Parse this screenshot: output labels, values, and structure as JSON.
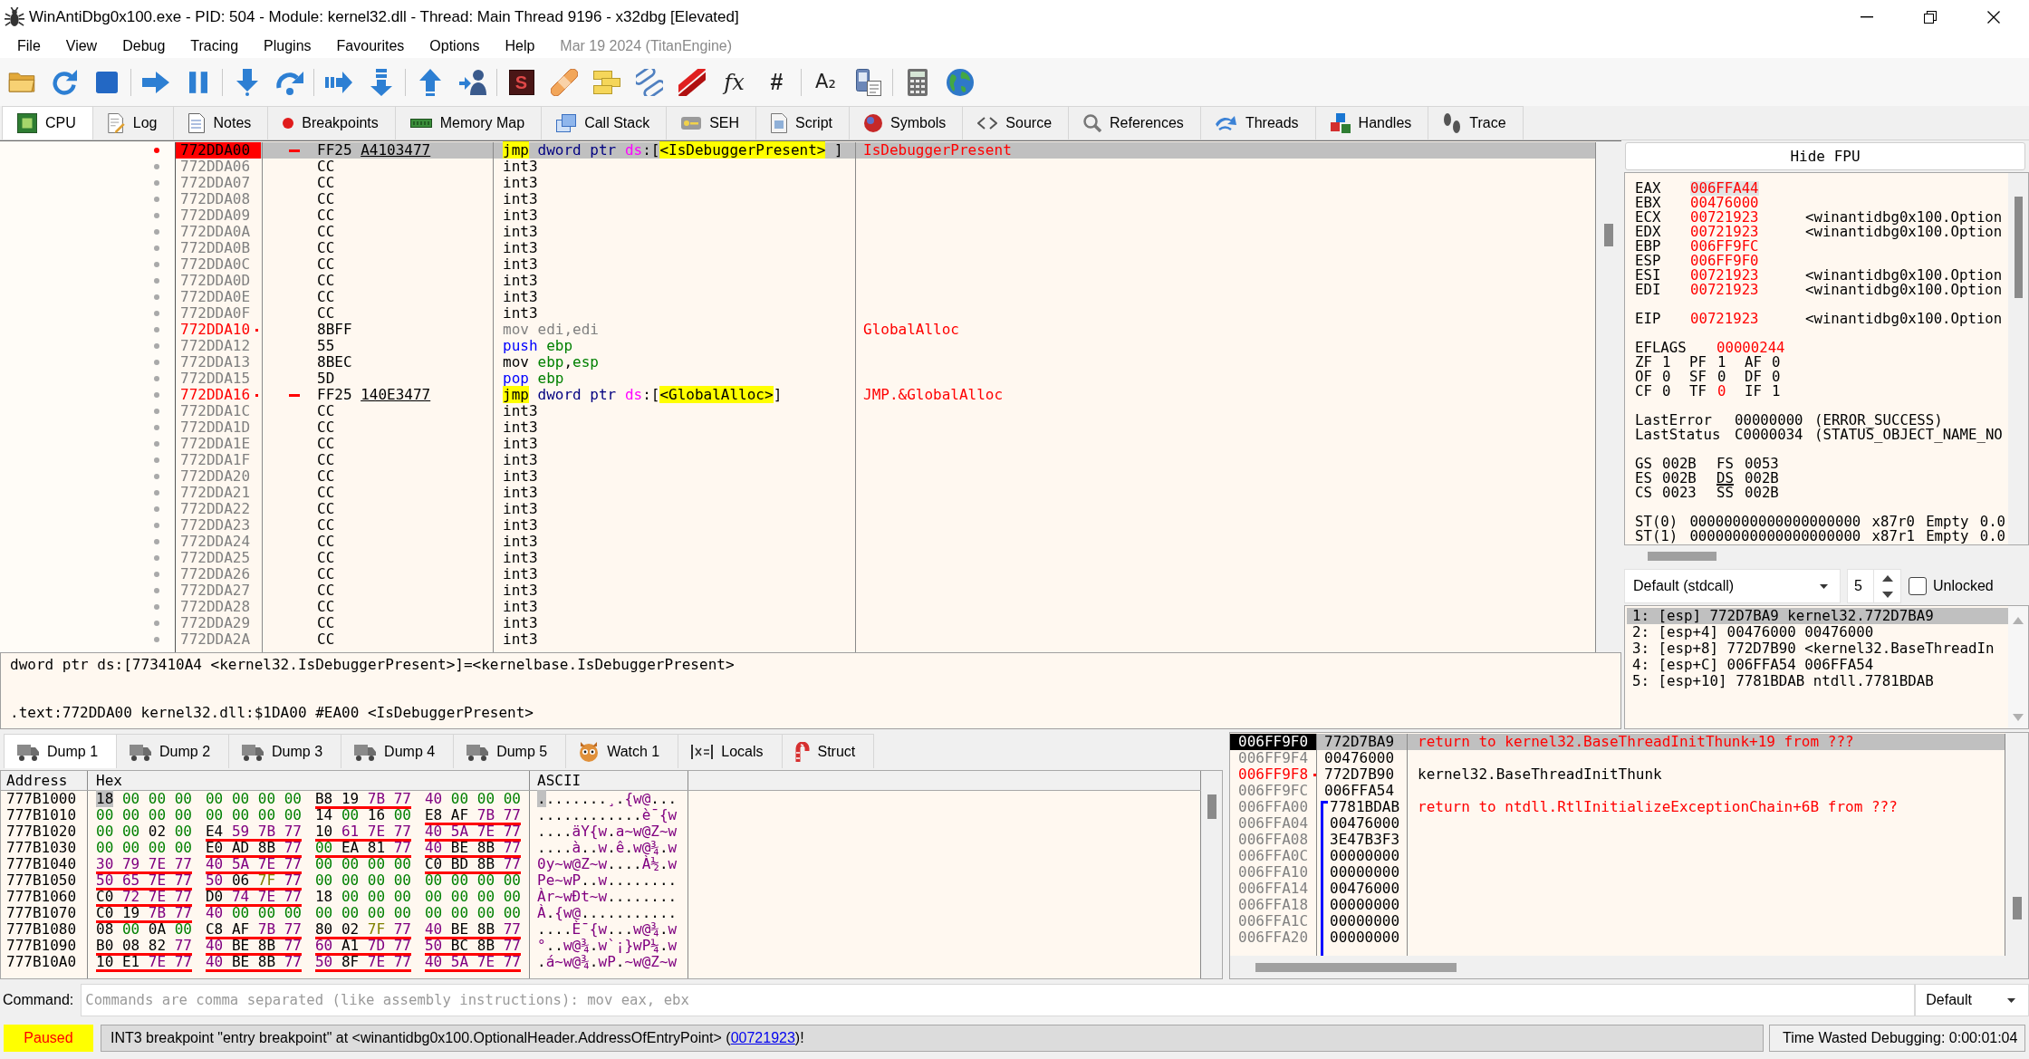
{
  "window": {
    "title": "WinAntiDbg0x100.exe - PID: 504 - Module: kernel32.dll - Thread: Main Thread 9196 - x32dbg [Elevated]"
  },
  "menu": {
    "items": [
      "File",
      "View",
      "Debug",
      "Tracing",
      "Plugins",
      "Favourites",
      "Options",
      "Help"
    ],
    "build": "Mar 19 2024 (TitanEngine)"
  },
  "toolbar": {
    "glyph_buttons": [
      "S",
      "fx",
      "#",
      "A₂"
    ]
  },
  "tabs": [
    {
      "label": "CPU",
      "kind": "cpu",
      "selected": true
    },
    {
      "label": "Log",
      "kind": "log",
      "selected": false
    },
    {
      "label": "Notes",
      "kind": "notes",
      "selected": false
    },
    {
      "label": "Breakpoints",
      "kind": "breakpoints",
      "selected": false
    },
    {
      "label": "Memory Map",
      "kind": "memory",
      "selected": false
    },
    {
      "label": "Call Stack",
      "kind": "callstack",
      "selected": false
    },
    {
      "label": "SEH",
      "kind": "seh",
      "selected": false
    },
    {
      "label": "Script",
      "kind": "script",
      "selected": false
    },
    {
      "label": "Symbols",
      "kind": "symbols",
      "selected": false
    },
    {
      "label": "Source",
      "kind": "source",
      "selected": false
    },
    {
      "label": "References",
      "kind": "references",
      "selected": false
    },
    {
      "label": "Threads",
      "kind": "threads",
      "selected": false
    },
    {
      "label": "Handles",
      "kind": "handles",
      "selected": false
    },
    {
      "label": "Trace",
      "kind": "trace",
      "selected": false
    }
  ],
  "disassembly": {
    "rows": [
      {
        "address": "772DDA00",
        "labeled": false,
        "breakpoint": true,
        "selected": true,
        "jump": true,
        "bytes": "FF25",
        "reloc": "A4103477",
        "instruction": [
          {
            "text": "jmp",
            "kind": "branch"
          },
          {
            "text": " dword ptr ",
            "kind": "size"
          },
          {
            "text": "ds",
            "kind": "segment"
          },
          {
            "text": ":[",
            "kind": "punct"
          },
          {
            "text": "<IsDebuggerPresent>",
            "kind": "symbol"
          },
          {
            "text": " ]",
            "kind": "punct"
          }
        ],
        "comment": "IsDebuggerPresent"
      },
      {
        "address": "772DDA06",
        "labeled": false,
        "breakpoint": false,
        "selected": false,
        "jump": false,
        "bytes": "CC",
        "instruction": [
          {
            "text": "int3",
            "kind": "mnemonic"
          }
        ]
      },
      {
        "address": "772DDA07",
        "labeled": false,
        "breakpoint": false,
        "selected": false,
        "jump": false,
        "bytes": "CC",
        "instruction": [
          {
            "text": "int3",
            "kind": "mnemonic"
          }
        ]
      },
      {
        "address": "772DDA08",
        "labeled": false,
        "breakpoint": false,
        "selected": false,
        "jump": false,
        "bytes": "CC",
        "instruction": [
          {
            "text": "int3",
            "kind": "mnemonic"
          }
        ]
      },
      {
        "address": "772DDA09",
        "labeled": false,
        "breakpoint": false,
        "selected": false,
        "jump": false,
        "bytes": "CC",
        "instruction": [
          {
            "text": "int3",
            "kind": "mnemonic"
          }
        ]
      },
      {
        "address": "772DDA0A",
        "labeled": false,
        "breakpoint": false,
        "selected": false,
        "jump": false,
        "bytes": "CC",
        "instruction": [
          {
            "text": "int3",
            "kind": "mnemonic"
          }
        ]
      },
      {
        "address": "772DDA0B",
        "labeled": false,
        "breakpoint": false,
        "selected": false,
        "jump": false,
        "bytes": "CC",
        "instruction": [
          {
            "text": "int3",
            "kind": "mnemonic"
          }
        ]
      },
      {
        "address": "772DDA0C",
        "labeled": false,
        "breakpoint": false,
        "selected": false,
        "jump": false,
        "bytes": "CC",
        "instruction": [
          {
            "text": "int3",
            "kind": "mnemonic"
          }
        ]
      },
      {
        "address": "772DDA0D",
        "labeled": false,
        "breakpoint": false,
        "selected": false,
        "jump": false,
        "bytes": "CC",
        "instruction": [
          {
            "text": "int3",
            "kind": "mnemonic"
          }
        ]
      },
      {
        "address": "772DDA0E",
        "labeled": false,
        "breakpoint": false,
        "selected": false,
        "jump": false,
        "bytes": "CC",
        "instruction": [
          {
            "text": "int3",
            "kind": "mnemonic"
          }
        ]
      },
      {
        "address": "772DDA0F",
        "labeled": false,
        "breakpoint": false,
        "selected": false,
        "jump": false,
        "bytes": "CC",
        "instruction": [
          {
            "text": "int3",
            "kind": "mnemonic"
          }
        ]
      },
      {
        "address": "772DDA10",
        "labeled": true,
        "breakpoint": false,
        "selected": false,
        "jump": false,
        "bytes": "8BFF",
        "instruction": [
          {
            "text": "mov edi,edi",
            "kind": "nop"
          }
        ],
        "comment": "GlobalAlloc"
      },
      {
        "address": "772DDA12",
        "labeled": false,
        "breakpoint": false,
        "selected": false,
        "jump": false,
        "bytes": "55",
        "instruction": [
          {
            "text": "push",
            "kind": "stack"
          },
          {
            "text": " ebp",
            "kind": "register"
          }
        ]
      },
      {
        "address": "772DDA13",
        "labeled": false,
        "breakpoint": false,
        "selected": false,
        "jump": false,
        "bytes": "8BEC",
        "instruction": [
          {
            "text": "mov",
            "kind": "mnemonic"
          },
          {
            "text": " ebp",
            "kind": "register"
          },
          {
            "text": ",",
            "kind": "punct"
          },
          {
            "text": "esp",
            "kind": "register"
          }
        ]
      },
      {
        "address": "772DDA15",
        "labeled": false,
        "breakpoint": false,
        "selected": false,
        "jump": false,
        "bytes": "5D",
        "instruction": [
          {
            "text": "pop",
            "kind": "stack"
          },
          {
            "text": " ebp",
            "kind": "register"
          }
        ]
      },
      {
        "address": "772DDA16",
        "labeled": true,
        "breakpoint": false,
        "selected": false,
        "jump": true,
        "bytes": "FF25",
        "reloc": "140E3477",
        "instruction": [
          {
            "text": "jmp",
            "kind": "branch"
          },
          {
            "text": " dword ptr ",
            "kind": "size"
          },
          {
            "text": "ds",
            "kind": "segment"
          },
          {
            "text": ":[",
            "kind": "punct"
          },
          {
            "text": "<GlobalAlloc>",
            "kind": "symbol"
          },
          {
            "text": "]",
            "kind": "punct"
          }
        ],
        "comment": "JMP.&GlobalAlloc"
      },
      {
        "address": "772DDA1C",
        "labeled": false,
        "breakpoint": false,
        "selected": false,
        "jump": false,
        "bytes": "CC",
        "instruction": [
          {
            "text": "int3",
            "kind": "mnemonic"
          }
        ]
      },
      {
        "address": "772DDA1D",
        "labeled": false,
        "breakpoint": false,
        "selected": false,
        "jump": false,
        "bytes": "CC",
        "instruction": [
          {
            "text": "int3",
            "kind": "mnemonic"
          }
        ]
      },
      {
        "address": "772DDA1E",
        "labeled": false,
        "breakpoint": false,
        "selected": false,
        "jump": false,
        "bytes": "CC",
        "instruction": [
          {
            "text": "int3",
            "kind": "mnemonic"
          }
        ]
      },
      {
        "address": "772DDA1F",
        "labeled": false,
        "breakpoint": false,
        "selected": false,
        "jump": false,
        "bytes": "CC",
        "instruction": [
          {
            "text": "int3",
            "kind": "mnemonic"
          }
        ]
      },
      {
        "address": "772DDA20",
        "labeled": false,
        "breakpoint": false,
        "selected": false,
        "jump": false,
        "bytes": "CC",
        "instruction": [
          {
            "text": "int3",
            "kind": "mnemonic"
          }
        ]
      },
      {
        "address": "772DDA21",
        "labeled": false,
        "breakpoint": false,
        "selected": false,
        "jump": false,
        "bytes": "CC",
        "instruction": [
          {
            "text": "int3",
            "kind": "mnemonic"
          }
        ]
      },
      {
        "address": "772DDA22",
        "labeled": false,
        "breakpoint": false,
        "selected": false,
        "jump": false,
        "bytes": "CC",
        "instruction": [
          {
            "text": "int3",
            "kind": "mnemonic"
          }
        ]
      },
      {
        "address": "772DDA23",
        "labeled": false,
        "breakpoint": false,
        "selected": false,
        "jump": false,
        "bytes": "CC",
        "instruction": [
          {
            "text": "int3",
            "kind": "mnemonic"
          }
        ]
      },
      {
        "address": "772DDA24",
        "labeled": false,
        "breakpoint": false,
        "selected": false,
        "jump": false,
        "bytes": "CC",
        "instruction": [
          {
            "text": "int3",
            "kind": "mnemonic"
          }
        ]
      },
      {
        "address": "772DDA25",
        "labeled": false,
        "breakpoint": false,
        "selected": false,
        "jump": false,
        "bytes": "CC",
        "instruction": [
          {
            "text": "int3",
            "kind": "mnemonic"
          }
        ]
      },
      {
        "address": "772DDA26",
        "labeled": false,
        "breakpoint": false,
        "selected": false,
        "jump": false,
        "bytes": "CC",
        "instruction": [
          {
            "text": "int3",
            "kind": "mnemonic"
          }
        ]
      },
      {
        "address": "772DDA27",
        "labeled": false,
        "breakpoint": false,
        "selected": false,
        "jump": false,
        "bytes": "CC",
        "instruction": [
          {
            "text": "int3",
            "kind": "mnemonic"
          }
        ]
      },
      {
        "address": "772DDA28",
        "labeled": false,
        "breakpoint": false,
        "selected": false,
        "jump": false,
        "bytes": "CC",
        "instruction": [
          {
            "text": "int3",
            "kind": "mnemonic"
          }
        ]
      },
      {
        "address": "772DDA29",
        "labeled": false,
        "breakpoint": false,
        "selected": false,
        "jump": false,
        "bytes": "CC",
        "instruction": [
          {
            "text": "int3",
            "kind": "mnemonic"
          }
        ]
      },
      {
        "address": "772DDA2A",
        "labeled": false,
        "breakpoint": false,
        "selected": false,
        "jump": false,
        "bytes": "CC",
        "instruction": [
          {
            "text": "int3",
            "kind": "mnemonic"
          }
        ]
      }
    ]
  },
  "info": {
    "lines": [
      "dword ptr ds:[773410A4 <kernel32.IsDebuggerPresent>]=<kernelbase.IsDebuggerPresent>",
      ".text:772DDA00 kernel32.dll:$1DA00 #EA00 <IsDebuggerPresent>"
    ]
  },
  "registers": {
    "toggle": "Hide FPU",
    "general": [
      {
        "name": "EAX",
        "value": "006FFA44",
        "changed": true,
        "selected": true
      },
      {
        "name": "EBX",
        "value": "00476000",
        "changed": true,
        "selected": false
      },
      {
        "name": "ECX",
        "value": "00721923",
        "changed": true,
        "selected": false,
        "comment": "<winantidbg0x100.Option"
      },
      {
        "name": "EDX",
        "value": "00721923",
        "changed": true,
        "selected": false,
        "comment": "<winantidbg0x100.Option"
      },
      {
        "name": "EBP",
        "value": "006FF9FC",
        "changed": true,
        "selected": false
      },
      {
        "name": "ESP",
        "value": "006FF9F0",
        "changed": true,
        "selected": false
      },
      {
        "name": "ESI",
        "value": "00721923",
        "changed": true,
        "selected": false,
        "comment": "<winantidbg0x100.Option"
      },
      {
        "name": "EDI",
        "value": "00721923",
        "changed": true,
        "selected": false,
        "comment": "<winantidbg0x100.Option"
      }
    ],
    "instruction_pointer": {
      "name": "EIP",
      "value": "00721923",
      "changed": true,
      "selected": false,
      "comment": "<winantidbg0x100.Option"
    },
    "eflags": {
      "name": "EFLAGS",
      "value": "00000244",
      "changed": true
    },
    "flags": [
      {
        "name": "ZF",
        "value": "1",
        "changed": false
      },
      {
        "name": "PF",
        "value": "1",
        "changed": false
      },
      {
        "name": "AF",
        "value": "0",
        "changed": false
      },
      {
        "name": "OF",
        "value": "0",
        "changed": false
      },
      {
        "name": "SF",
        "value": "0",
        "changed": false
      },
      {
        "name": "DF",
        "value": "0",
        "changed": false
      },
      {
        "name": "CF",
        "value": "0",
        "changed": false
      },
      {
        "name": "TF",
        "value": "0",
        "changed": true
      },
      {
        "name": "IF",
        "value": "1",
        "changed": false
      }
    ],
    "last": [
      {
        "name": "LastError",
        "value": "00000000",
        "comment": "(ERROR_SUCCESS)"
      },
      {
        "name": "LastStatus",
        "value": "C0000034",
        "comment": "(STATUS_OBJECT_NAME_NO"
      }
    ],
    "segments": [
      {
        "name": "GS",
        "value": "002B",
        "in_use": false
      },
      {
        "name": "FS",
        "value": "0053",
        "in_use": false
      },
      {
        "name": "ES",
        "value": "002B",
        "in_use": false
      },
      {
        "name": "DS",
        "value": "002B",
        "in_use": true
      },
      {
        "name": "CS",
        "value": "0023",
        "in_use": false
      },
      {
        "name": "SS",
        "value": "002B",
        "in_use": false
      }
    ],
    "fpu": [
      {
        "name": "ST(0)",
        "value": "00000000000000000000",
        "register": "x87r0",
        "tag": "Empty",
        "number": "0.0"
      },
      {
        "name": "ST(1)",
        "value": "00000000000000000000",
        "register": "x87r1",
        "tag": "Empty",
        "number": "0.0"
      }
    ]
  },
  "call_args": {
    "convention": "Default (stdcall)",
    "count": "5",
    "checkbox": {
      "label": "Unlocked",
      "checked": false
    },
    "rows": [
      {
        "text": "1: [esp] 772D7BA9 kernel32.772D7BA9",
        "selected": true
      },
      {
        "text": "2: [esp+4] 00476000 00476000",
        "selected": false
      },
      {
        "text": "3: [esp+8] 772D7B90 <kernel32.BaseThreadIn",
        "selected": false
      },
      {
        "text": "4: [esp+C] 006FFA54 006FFA54",
        "selected": false
      },
      {
        "text": "5: [esp+10] 7781BDAB ntdll.7781BDAB",
        "selected": false
      }
    ]
  },
  "dump": {
    "tabs": [
      {
        "label": "Dump 1",
        "kind": "dump",
        "selected": true
      },
      {
        "label": "Dump 2",
        "kind": "dump",
        "selected": false
      },
      {
        "label": "Dump 3",
        "kind": "dump",
        "selected": false
      },
      {
        "label": "Dump 4",
        "kind": "dump",
        "selected": false
      },
      {
        "label": "Dump 5",
        "kind": "dump",
        "selected": false
      },
      {
        "label": "Watch 1",
        "kind": "watch",
        "selected": false
      },
      {
        "label": "Locals",
        "kind": "locals",
        "selected": false
      },
      {
        "label": "Struct",
        "kind": "struct",
        "selected": false
      }
    ],
    "columns": [
      "Address",
      "Hex",
      "ASCII"
    ],
    "rows": [
      {
        "address": "777B1000",
        "selected": true,
        "groups": [
          {
            "bytes": "18 00 00 00",
            "pointer": false
          },
          {
            "bytes": "00 00 00 00",
            "pointer": false
          },
          {
            "bytes": "B8 19 7B 77",
            "pointer": true
          },
          {
            "bytes": "40 00 00 00",
            "pointer": false
          }
        ],
        "ascii": "........¸.{w@..."
      },
      {
        "address": "777B1010",
        "selected": false,
        "groups": [
          {
            "bytes": "00 00 00 00",
            "pointer": false
          },
          {
            "bytes": "00 00 00 00",
            "pointer": false
          },
          {
            "bytes": "14 00 16 00",
            "pointer": false
          },
          {
            "bytes": "E8 AF 7B 77",
            "pointer": true
          }
        ],
        "ascii": "............è¯{w"
      },
      {
        "address": "777B1020",
        "selected": false,
        "groups": [
          {
            "bytes": "00 00 02 00",
            "pointer": false
          },
          {
            "bytes": "E4 59 7B 77",
            "pointer": true
          },
          {
            "bytes": "10 61 7E 77",
            "pointer": true
          },
          {
            "bytes": "40 5A 7E 77",
            "pointer": true
          }
        ],
        "ascii": "....äY{w.a~w@Z~w"
      },
      {
        "address": "777B1030",
        "selected": false,
        "groups": [
          {
            "bytes": "00 00 00 00",
            "pointer": false
          },
          {
            "bytes": "E0 AD 8B 77",
            "pointer": true
          },
          {
            "bytes": "00 EA 81 77",
            "pointer": true
          },
          {
            "bytes": "40 BE 8B 77",
            "pointer": true
          }
        ],
        "ascii": "....à..w.ê.w@¾.w"
      },
      {
        "address": "777B1040",
        "selected": false,
        "groups": [
          {
            "bytes": "30 79 7E 77",
            "pointer": true
          },
          {
            "bytes": "40 5A 7E 77",
            "pointer": true
          },
          {
            "bytes": "00 00 00 00",
            "pointer": false
          },
          {
            "bytes": "C0 BD 8B 77",
            "pointer": true
          }
        ],
        "ascii": "0y~w@Z~w....À½.w"
      },
      {
        "address": "777B1050",
        "selected": false,
        "groups": [
          {
            "bytes": "50 65 7E 77",
            "pointer": true
          },
          {
            "bytes": "50 06 7F 77",
            "pointer": true
          },
          {
            "bytes": "00 00 00 00",
            "pointer": false
          },
          {
            "bytes": "00 00 00 00",
            "pointer": false
          }
        ],
        "ascii": "Pe~wP..w........"
      },
      {
        "address": "777B1060",
        "selected": false,
        "groups": [
          {
            "bytes": "C0 72 7E 77",
            "pointer": true
          },
          {
            "bytes": "D0 74 7E 77",
            "pointer": true
          },
          {
            "bytes": "18 00 00 00",
            "pointer": false
          },
          {
            "bytes": "00 00 00 00",
            "pointer": false
          }
        ],
        "ascii": "Àr~wÐt~w........"
      },
      {
        "address": "777B1070",
        "selected": false,
        "groups": [
          {
            "bytes": "C0 19 7B 77",
            "pointer": true
          },
          {
            "bytes": "40 00 00 00",
            "pointer": false
          },
          {
            "bytes": "00 00 00 00",
            "pointer": false
          },
          {
            "bytes": "00 00 00 00",
            "pointer": false
          }
        ],
        "ascii": "À.{w@..........."
      },
      {
        "address": "777B1080",
        "selected": false,
        "groups": [
          {
            "bytes": "08 00 0A 00",
            "pointer": false
          },
          {
            "bytes": "C8 AF 7B 77",
            "pointer": true
          },
          {
            "bytes": "80 02 7F 77",
            "pointer": true
          },
          {
            "bytes": "40 BE 8B 77",
            "pointer": true
          }
        ],
        "ascii": "....È¯{w...w@¾.w"
      },
      {
        "address": "777B1090",
        "selected": false,
        "groups": [
          {
            "bytes": "B0 08 82 77",
            "pointer": true
          },
          {
            "bytes": "40 BE 8B 77",
            "pointer": true
          },
          {
            "bytes": "60 A1 7D 77",
            "pointer": true
          },
          {
            "bytes": "50 BC 8B 77",
            "pointer": true
          }
        ],
        "ascii": "°..w@¾.w`¡}wP¼.w"
      },
      {
        "address": "777B10A0",
        "selected": false,
        "groups": [
          {
            "bytes": "10 E1 7E 77",
            "pointer": true
          },
          {
            "bytes": "40 BE 8B 77",
            "pointer": true
          },
          {
            "bytes": "50 8F 7E 77",
            "pointer": true
          },
          {
            "bytes": "40 5A 7E 77",
            "pointer": true
          }
        ],
        "ascii": ".á~w@¾.wP.~w@Z~w"
      }
    ]
  },
  "stack": {
    "rows": [
      {
        "address": "006FF9F0",
        "value": "772D7BA9",
        "selected": true,
        "labeled": false,
        "comment": {
          "text": "return to kernel32.BaseThreadInitThunk+19 from ???",
          "kind": "return"
        }
      },
      {
        "address": "006FF9F4",
        "value": "00476000",
        "selected": false,
        "labeled": false
      },
      {
        "address": "006FF9F8",
        "value": "772D7B90",
        "selected": false,
        "labeled": true,
        "comment": {
          "text": "kernel32.BaseThreadInitThunk",
          "kind": "symbol"
        }
      },
      {
        "address": "006FF9FC",
        "value": "006FFA54",
        "selected": false,
        "labeled": false
      }
    ],
    "frame": {
      "rows": [
        {
          "address": "006FFA00",
          "value": "7781BDAB",
          "selected": false,
          "labeled": false,
          "comment": {
            "text": "return to ntdll.RtlInitializeExceptionChain+6B from ???",
            "kind": "return"
          }
        },
        {
          "address": "006FFA04",
          "value": "00476000",
          "selected": false,
          "labeled": false
        },
        {
          "address": "006FFA08",
          "value": "3E47B3F3",
          "selected": false,
          "labeled": false
        },
        {
          "address": "006FFA0C",
          "value": "00000000",
          "selected": false,
          "labeled": false
        },
        {
          "address": "006FFA10",
          "value": "00000000",
          "selected": false,
          "labeled": false
        },
        {
          "address": "006FFA14",
          "value": "00476000",
          "selected": false,
          "labeled": false
        },
        {
          "address": "006FFA18",
          "value": "00000000",
          "selected": false,
          "labeled": false
        },
        {
          "address": "006FFA1C",
          "value": "00000000",
          "selected": false,
          "labeled": false
        },
        {
          "address": "006FFA20",
          "value": "00000000",
          "selected": false,
          "labeled": false
        }
      ]
    }
  },
  "command": {
    "label": "Command:",
    "placeholder": "Commands are comma separated (like assembly instructions): mov eax, ebx",
    "mode": "Default"
  },
  "status": {
    "state": "Paused",
    "message": [
      {
        "text": "INT3 breakpoint \"entry breakpoint\" at <winantidbg0x100.OptionalHeader.AddressOfEntryPoint> (",
        "kind": "plain"
      },
      {
        "text": "00721923",
        "kind": "link"
      },
      {
        "text": ")!",
        "kind": "plain"
      }
    ],
    "timer": "Time Wasted Debugging: 0:00:01:04"
  }
}
